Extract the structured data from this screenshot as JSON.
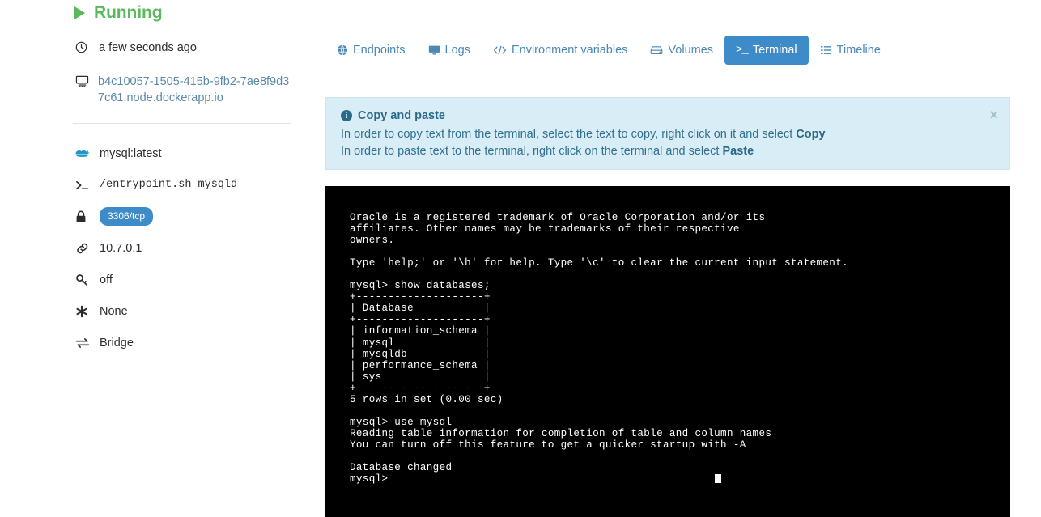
{
  "sidebar": {
    "status": {
      "label": "Running",
      "color": "#5cb85c",
      "icon": "play-icon"
    },
    "time": {
      "label": "a few seconds ago",
      "icon": "clock-icon"
    },
    "host": {
      "label": "b4c10057-1505-415b-9fb2-7ae8f9d37c61.node.dockerapp.io",
      "icon": "monitor-icon"
    },
    "items": [
      {
        "icon": "docker-whale-icon",
        "label": "mysql:latest",
        "type": "text"
      },
      {
        "icon": "terminal-prompt-icon",
        "label": "/entrypoint.sh mysqld",
        "type": "mono"
      },
      {
        "icon": "lock-icon",
        "label": "3306/tcp",
        "type": "badge",
        "badge_color": "#3e8bc9"
      },
      {
        "icon": "link-icon",
        "label": "10.7.0.1",
        "type": "text"
      },
      {
        "icon": "key-icon",
        "label": "off",
        "type": "text"
      },
      {
        "icon": "asterisk-icon",
        "label": "None",
        "type": "text"
      },
      {
        "icon": "exchange-icon",
        "label": "Bridge",
        "type": "text"
      }
    ]
  },
  "tabs": [
    {
      "label": "Endpoints",
      "icon": "globe-icon",
      "active": false
    },
    {
      "label": "Logs",
      "icon": "monitor-icon",
      "active": false
    },
    {
      "label": "Environment variables",
      "icon": "code-icon",
      "active": false
    },
    {
      "label": "Volumes",
      "icon": "hdd-icon",
      "active": false
    },
    {
      "label": "Terminal",
      "icon": "terminal-prompt-icon",
      "active": true
    },
    {
      "label": "Timeline",
      "icon": "list-icon",
      "active": false
    }
  ],
  "alert": {
    "title": "Copy and paste",
    "icon": "info-icon",
    "close_label": "×",
    "line1_prefix": "In order to copy text from the terminal, select the text to copy, right click on it and select ",
    "line1_bold": "Copy",
    "line2_prefix": "In order to paste text to the terminal, right click on the terminal and select ",
    "line2_bold": "Paste",
    "background": "#d9edf7",
    "text_color": "#31708f"
  },
  "terminal": {
    "background": "#000000",
    "foreground": "#ffffff",
    "content": "Oracle is a registered trademark of Oracle Corporation and/or its\naffiliates. Other names may be trademarks of their respective\nowners.\n\nType 'help;' or '\\h' for help. Type '\\c' to clear the current input statement.\n\nmysql> show databases;\n+--------------------+\n| Database           |\n+--------------------+\n| information_schema |\n| mysql              |\n| mysqldb            |\n| performance_schema |\n| sys                |\n+--------------------+\n5 rows in set (0.00 sec)\n\nmysql> use mysql\nReading table information for completion of table and column names\nYou can turn off this feature to get a quicker startup with -A\n\nDatabase changed\nmysql> ",
    "prompt": "mysql> ",
    "cursor": "block"
  }
}
